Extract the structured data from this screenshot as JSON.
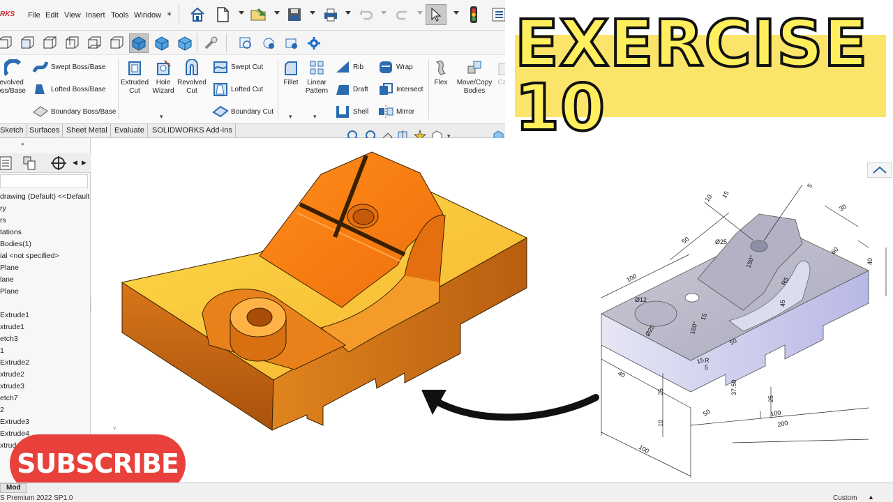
{
  "app": {
    "logo": "RKS",
    "menu": [
      "File",
      "Edit",
      "View",
      "Insert",
      "Tools",
      "Window"
    ]
  },
  "features": {
    "revolved_boss": "Revolved\nBoss/Base",
    "swept_boss": "Swept Boss/Base",
    "lofted_boss": "Lofted Boss/Base",
    "boundary_boss": "Boundary Boss/Base",
    "extruded_cut": "Extruded\nCut",
    "hole_wizard": "Hole\nWizard",
    "revolved_cut": "Revolved\nCut",
    "swept_cut": "Swept Cut",
    "lofted_cut": "Lofted Cut",
    "boundary_cut": "Boundary Cut",
    "fillet": "Fillet",
    "linear_pattern": "Linear\nPattern",
    "rib": "Rib",
    "draft": "Draft",
    "shell": "Shell",
    "wrap": "Wrap",
    "intersect": "Intersect",
    "mirror": "Mirror",
    "flex": "Flex",
    "move_copy": "Move/Copy\nBodies",
    "ca": "Ca"
  },
  "tabs": [
    "Sketch",
    "Surfaces",
    "Sheet Metal",
    "Evaluate",
    "SOLIDWORKS Add-Ins"
  ],
  "tree": {
    "items": [
      "drawing (Default) <<Default",
      "ry",
      "rs",
      "tations",
      "Bodies(1)",
      "ial <not specified>",
      "Plane",
      "lane",
      "Plane",
      "",
      "Extrude1",
      "xtrude1",
      "etch3",
      "1",
      "Extrude2",
      "xtrude2",
      "xtrude3",
      "etch7",
      "2",
      "Extrude3",
      "Extrude4",
      "xtrude4"
    ]
  },
  "model_tab": "Mod",
  "status": {
    "left": "S Premium 2022 SP1.0",
    "right": "Custom"
  },
  "banner": {
    "title": "EXERCISE 10"
  },
  "subscribe": {
    "label": "SUBSCRIBE"
  },
  "drawing": {
    "dims": [
      "100",
      "10",
      "15",
      "50",
      "Ø25",
      "5",
      "30",
      "60",
      "40",
      "150°",
      "R5",
      "45",
      "Ø12",
      "15",
      "Ø25",
      "160°",
      "50",
      "15",
      "40",
      "25",
      "10",
      "50",
      "37.50",
      "25",
      "100",
      "200",
      "100",
      "R",
      "5"
    ]
  },
  "axis_label": "Y",
  "colors": {
    "banner_bg": "#fbe46a",
    "subscribe_bg": "#e8413c",
    "part_orange": "#f08a1c",
    "part_light": "#ffd24d"
  }
}
